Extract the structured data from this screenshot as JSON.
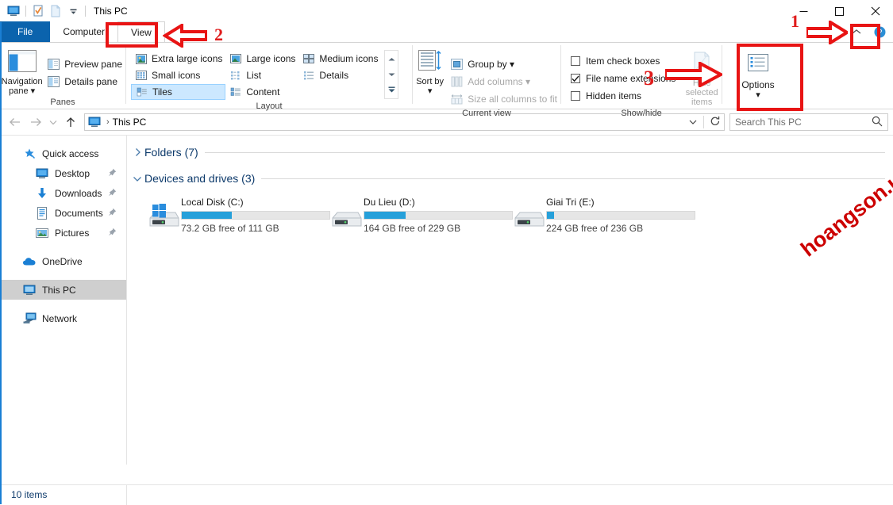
{
  "window": {
    "title": "This PC",
    "quick_access_toolbar": [
      "this-pc-icon",
      "properties-icon",
      "new-folder-icon",
      "customize-dropdown-icon"
    ],
    "controls": {
      "minimize": "minimize-icon",
      "maximize": "maximize-icon",
      "close": "close-icon",
      "collapse_ribbon": "chevron-up-icon",
      "help": "help-icon"
    }
  },
  "tabs": [
    {
      "label": "File",
      "type": "file"
    },
    {
      "label": "Computer",
      "type": "normal"
    },
    {
      "label": "View",
      "type": "active"
    }
  ],
  "ribbon": {
    "groups": [
      {
        "label": "Panes",
        "big_button": {
          "label": "Navigation pane",
          "caret": "▾"
        },
        "items": [
          {
            "label": "Preview pane",
            "disabled": false
          },
          {
            "label": "Details pane",
            "disabled": false
          }
        ]
      },
      {
        "label": "Layout",
        "items": [
          {
            "label": "Extra large icons",
            "selected": false
          },
          {
            "label": "Large icons",
            "selected": false
          },
          {
            "label": "Medium icons",
            "selected": false
          },
          {
            "label": "Small icons",
            "selected": false
          },
          {
            "label": "List",
            "selected": false
          },
          {
            "label": "Details",
            "selected": false
          },
          {
            "label": "Tiles",
            "selected": true
          },
          {
            "label": "Content",
            "selected": false
          }
        ]
      },
      {
        "label": "Current view",
        "big_button": {
          "label": "Sort by",
          "caret": "▾"
        },
        "items": [
          {
            "label": "Group by",
            "caret": "▾",
            "disabled": false
          },
          {
            "label": "Add columns",
            "caret": "▾",
            "disabled": true
          },
          {
            "label": "Size all columns to fit",
            "disabled": true
          }
        ]
      },
      {
        "label": "Show/hide",
        "checkboxes": [
          {
            "label": "Item check boxes",
            "checked": false
          },
          {
            "label": "File name extensions",
            "checked": true
          },
          {
            "label": "Hidden items",
            "checked": false
          }
        ],
        "big_button_disabled": {
          "label": "Hide selected items"
        }
      },
      {
        "label": "",
        "big_button": {
          "label": "Options",
          "caret": "▾"
        }
      }
    ]
  },
  "address_bar": {
    "back": "back-arrow-icon",
    "forward": "forward-arrow-icon",
    "recent": "chevron-down-icon",
    "up": "up-arrow-icon",
    "breadcrumb": [
      "This PC"
    ],
    "dropdown": "chevron-down-icon",
    "refresh": "refresh-icon",
    "search_placeholder": "Search This PC"
  },
  "sidebar": {
    "items": [
      {
        "label": "Quick access",
        "icon": "star-pin-icon",
        "child": false,
        "pinned": false,
        "selected": false
      },
      {
        "label": "Desktop",
        "icon": "desktop-icon",
        "child": true,
        "pinned": true,
        "selected": false
      },
      {
        "label": "Downloads",
        "icon": "downloads-icon",
        "child": true,
        "pinned": true,
        "selected": false
      },
      {
        "label": "Documents",
        "icon": "documents-icon",
        "child": true,
        "pinned": true,
        "selected": false
      },
      {
        "label": "Pictures",
        "icon": "pictures-icon",
        "child": true,
        "pinned": true,
        "selected": false
      },
      {
        "label": "OneDrive",
        "icon": "onedrive-cloud-icon",
        "child": false,
        "pinned": false,
        "selected": false
      },
      {
        "label": "This PC",
        "icon": "this-pc-icon",
        "child": false,
        "pinned": false,
        "selected": true
      },
      {
        "label": "Network",
        "icon": "network-icon",
        "child": false,
        "pinned": false,
        "selected": false
      }
    ]
  },
  "content": {
    "groups": [
      {
        "title": "Folders (7)",
        "expanded": false
      },
      {
        "title": "Devices and drives (3)",
        "expanded": true
      }
    ],
    "drives": [
      {
        "name": "Local Disk (C:)",
        "free_text": "73.2 GB free of 111 GB",
        "used_percent": 34,
        "icon": "windows-drive-icon"
      },
      {
        "name": "Du Lieu (D:)",
        "free_text": "164 GB free of 229 GB",
        "used_percent": 28,
        "icon": "drive-icon"
      },
      {
        "name": "Giai Tri (E:)",
        "free_text": "224 GB free of 236 GB",
        "used_percent": 5,
        "icon": "drive-icon"
      }
    ]
  },
  "status_bar": {
    "items_count": "10 items"
  },
  "annotations": {
    "markers": [
      {
        "number": "1",
        "target": "ribbon-collapse-chevron"
      },
      {
        "number": "2",
        "target": "view-tab"
      },
      {
        "number": "3",
        "target": "options-button"
      }
    ],
    "watermark": "hoangson.us",
    "accent_red": "#e81414"
  }
}
